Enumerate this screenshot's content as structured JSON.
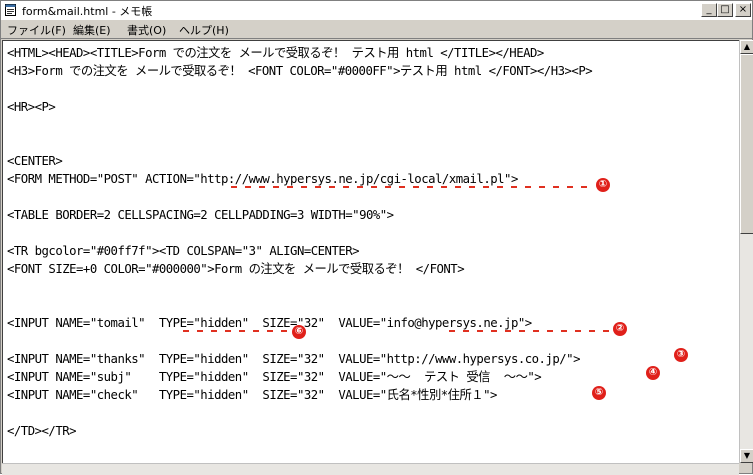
{
  "window": {
    "title": "form&mail.html - メモ帳",
    "controls": {
      "minimize": "_",
      "maximize": "□",
      "close": "×"
    }
  },
  "menu": {
    "items": [
      "ファイル(F)",
      "編集(E)",
      "書式(O)",
      "ヘルプ(H)"
    ]
  },
  "editor": {
    "lines": [
      "<HTML><HEAD><TITLE>Form での注文を メールで受取るぞ！ テスト用 html </TITLE></HEAD>",
      "<H3>Form での注文を メールで受取るぞ！ <FONT COLOR=\"#0000FF\">テスト用 html </FONT></H3><P>",
      "",
      "<HR><P>",
      "",
      "",
      "<CENTER>",
      "<FORM METHOD=\"POST\" ACTION=\"http://www.hypersys.ne.jp/cgi-local/xmail.pl\">",
      "",
      "<TABLE BORDER=2 CELLSPACING=2 CELLPADDING=3 WIDTH=\"90%\">",
      "",
      "<TR bgcolor=\"#00ff7f\"><TD COLSPAN=\"3\" ALIGN=CENTER>",
      "<FONT SIZE=+0 COLOR=\"#000000\">Form の注文を メールで受取るぞ！ </FONT>",
      "",
      "",
      "<INPUT NAME=\"tomail\"  TYPE=\"hidden\"  SIZE=\"32\"  VALUE=\"info@hypersys.ne.jp\">",
      "",
      "<INPUT NAME=\"thanks\"  TYPE=\"hidden\"  SIZE=\"32\"  VALUE=\"http://www.hypersys.co.jp/\">",
      "<INPUT NAME=\"subj\"    TYPE=\"hidden\"  SIZE=\"32\"  VALUE=\"〜〜  テスト 受信  〜〜\">",
      "<INPUT NAME=\"check\"   TYPE=\"hidden\"  SIZE=\"32\"  VALUE=\"氏名*性別*住所１\">",
      "",
      "</TD></TR>"
    ]
  },
  "annotations": {
    "marker_color": "#e0201a",
    "labels": [
      "①",
      "②",
      "③",
      "④",
      "⑤",
      "⑥"
    ]
  }
}
